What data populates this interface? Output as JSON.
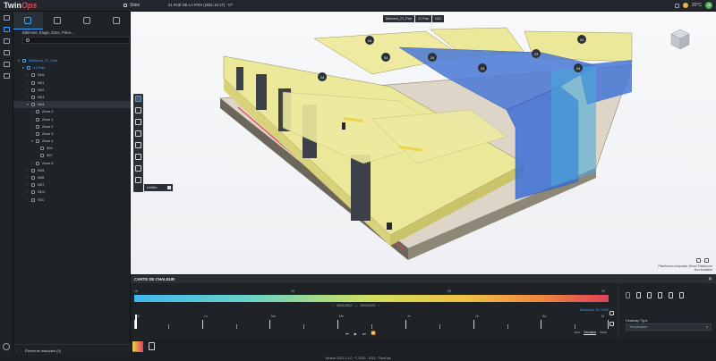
{
  "header": {
    "logo_a": "Twin",
    "logo_b": "Ops",
    "sites_label": "Sites",
    "breadcrumb": "21 RUE DE LA PAIX (2021.10.17) · V7",
    "weather": "20°C",
    "user_initial": "JB"
  },
  "panel": {
    "title": "Bâtiment, Étage, Zone, Pièce...",
    "search_placeholder": "",
    "tree": [
      {
        "label": "Bâtiment_21_Paix",
        "depth": 0,
        "chev": "▾",
        "blue": true
      },
      {
        "label": "21 Paix",
        "depth": 1,
        "chev": "▾",
        "blue": true
      },
      {
        "label": "DN1",
        "depth": 2,
        "chev": "›"
      },
      {
        "label": "N01",
        "depth": 2,
        "chev": "›"
      },
      {
        "label": "N02",
        "depth": 2,
        "chev": "›"
      },
      {
        "label": "N03",
        "depth": 2,
        "chev": "›"
      },
      {
        "label": "N04",
        "depth": 2,
        "chev": "▾",
        "selected": true
      },
      {
        "label": "Zone 0",
        "depth": 3,
        "chev": "›"
      },
      {
        "label": "Zone 1",
        "depth": 3,
        "chev": "›"
      },
      {
        "label": "Zone 2",
        "depth": 3,
        "chev": "›"
      },
      {
        "label": "Zone 3",
        "depth": 3,
        "chev": "›"
      },
      {
        "label": "Zone 4",
        "depth": 3,
        "chev": "▾"
      },
      {
        "label": "404",
        "depth": 4,
        "chev": ""
      },
      {
        "label": "407",
        "depth": 4,
        "chev": ""
      },
      {
        "label": "Zone 5",
        "depth": 3,
        "chev": "›"
      },
      {
        "label": "N05",
        "depth": 2,
        "chev": "›"
      },
      {
        "label": "N06",
        "depth": 2,
        "chev": "›"
      },
      {
        "label": "N07",
        "depth": 2,
        "chev": "›"
      },
      {
        "label": "RDC",
        "depth": 2,
        "chev": "›"
      },
      {
        "label": "S01",
        "depth": 2,
        "chev": "›"
      }
    ],
    "hidden_elements": "Éléments masqués (0)"
  },
  "viewport": {
    "breadcrumb": [
      "Bâtiment_21_Paix",
      "21 Paix",
      "N04"
    ],
    "unit": "Unités",
    "credit_line1": "Plateforme composée: Bexel Plateforme",
    "credit_line2": "Non localisée",
    "room_markers": [
      "24",
      "24",
      "24",
      "24",
      "24",
      "23",
      "23",
      "24"
    ]
  },
  "heatmap": {
    "title": "CARTE DE CHALEUR",
    "scale_labels": [
      "15",
      "20",
      "25",
      "30"
    ],
    "range_from": "08/01/2022",
    "range_to": "15/01/2022",
    "current_date": "Dimanche 15, 23:59",
    "timeline_labels": [
      "08",
      "Lu",
      "Ma",
      "Me",
      "Je",
      "Ve",
      "Sa",
      "Di"
    ],
    "periods": [
      "Jour",
      "Semaine",
      "Mois"
    ],
    "active_period": "Semaine",
    "heatmap_type_label": "Heatmap Type",
    "heatmap_type_value": "Température"
  },
  "footer": {
    "text": "Version 2022.2.1-0 · © 2020 - 2022 · TwinOps"
  },
  "colors": {
    "accent": "#3aa0ff",
    "brand": "#e2405a",
    "zone_yellow": "#ece89a",
    "zone_blue": "#3b6fd6"
  }
}
